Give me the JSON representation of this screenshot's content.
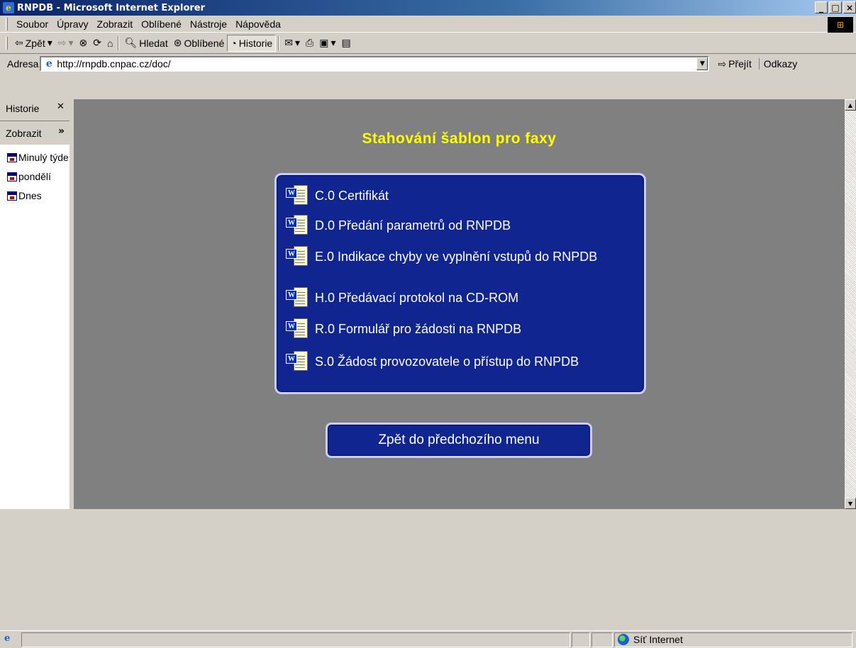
{
  "window": {
    "title": "RNPDB - Microsoft Internet Explorer",
    "icon": "ie-icon",
    "controls": [
      "_",
      "×"
    ]
  },
  "menu": {
    "items": [
      "Soubor",
      "Úpravy",
      "Zobrazit",
      "Oblíbené",
      "Nástroje",
      "Nápověda"
    ]
  },
  "toolbar": {
    "back": "Zpět",
    "search": "Hledat",
    "favorites": "Oblíbené",
    "history": "Historie"
  },
  "address": {
    "label": "Adresa",
    "url": "http://rnpdb.cnpac.cz/doc/",
    "go": "Přejít",
    "links": "Odkazy"
  },
  "sidebar": {
    "title": "Historie",
    "view": "Zobrazit",
    "items": [
      "Minulý týden",
      "pondělí",
      "Dnes"
    ]
  },
  "page": {
    "heading": "Stahování šablon pro faxy",
    "documents": [
      "C.0 Certifikát",
      "D.0 Předání parametrů od RNPDB",
      "E.0 Indikace chyby ve vyplnění vstupů do RNPDB",
      "H.0 Předávací protokol na CD-ROM",
      "R.0 Formulář pro žádosti na RNPDB",
      "S.0 Žádost provozovatele o přístup do RNPDB"
    ],
    "back_button": "Zpět do předchozího menu"
  },
  "status": {
    "zone": "Síť Internet"
  },
  "colors": {
    "heading": "#ffff00",
    "box_bg": "#102590",
    "box_border": "#c8ccff",
    "page_bg": "#808080"
  }
}
